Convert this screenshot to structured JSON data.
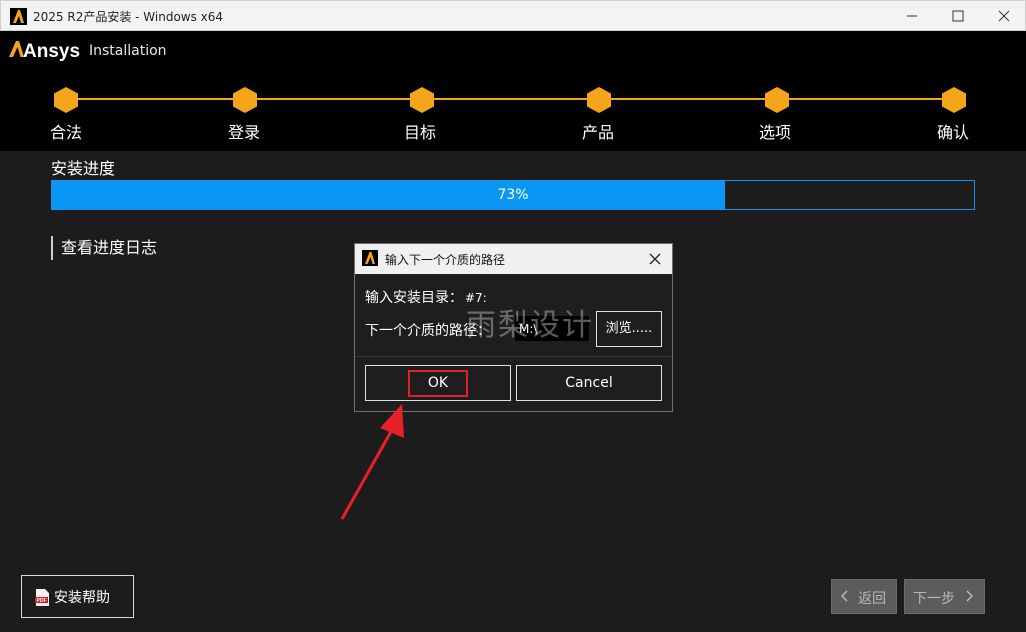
{
  "window": {
    "title": "2025 R2产品安装 - Windows x64",
    "controls": [
      "minimize-icon",
      "maximize-icon",
      "close-icon"
    ]
  },
  "header": {
    "brand": "Ansys",
    "subtitle": "Installation",
    "accent_color": "#f5a519",
    "steps": [
      {
        "label": "合法"
      },
      {
        "label": "登录"
      },
      {
        "label": "目标"
      },
      {
        "label": "产品"
      },
      {
        "label": "选项"
      },
      {
        "label": "确认"
      }
    ]
  },
  "main": {
    "progress_title": "安装进度",
    "progress_percent": 73,
    "progress_text": "73%",
    "progress_color": "#0a97f3",
    "log_link": "查看进度日志",
    "help_button": "安装帮助",
    "back_button": "返回",
    "next_button": "下一步"
  },
  "dialog": {
    "title": "输入下一个介质的路径",
    "install_dir_label": "输入安装目录：",
    "install_dir_value": "#7:",
    "media_path_label": "下一个介质的路径：",
    "media_path_value": "M:\\",
    "browse_button": "浏览.....",
    "ok_button": "OK",
    "cancel_button": "Cancel",
    "highlight_color": "#e0202a"
  },
  "watermark": "雨梨设计"
}
